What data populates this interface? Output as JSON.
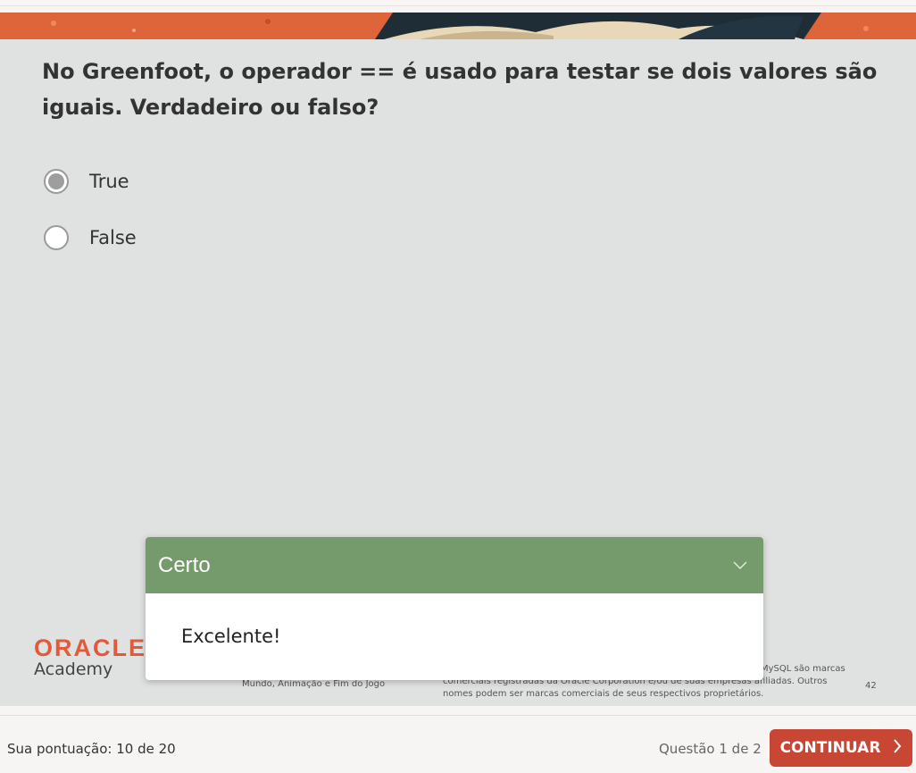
{
  "question": {
    "text": "No Greenfoot, o operador == é usado para testar se dois valores são iguais. Verdadeiro ou falso?",
    "options": [
      {
        "label": "True",
        "selected": true
      },
      {
        "label": "False",
        "selected": false
      }
    ]
  },
  "slide_footer": {
    "logo": "ORACLE",
    "academy": "Academy",
    "lesson": "Mundo, Animação e Fim do Jogo",
    "trademark_line1": "MySQL são marcas",
    "trademark_line2": "comerciais registradas da Oracle Corporation e/ou de suas empresas afiliadas. Outros",
    "trademark_line3": "nomes podem ser marcas comerciais de seus respectivos proprietários.",
    "page_number": "42"
  },
  "feedback": {
    "title": "Certo",
    "message": "Excelente!",
    "color": "#759b6c"
  },
  "bottom_bar": {
    "score": "Sua pontuação: 10 de 20",
    "question_count": "Questão 1 de 2",
    "continue_label": "CONTINUAR",
    "button_color": "#c74634"
  }
}
